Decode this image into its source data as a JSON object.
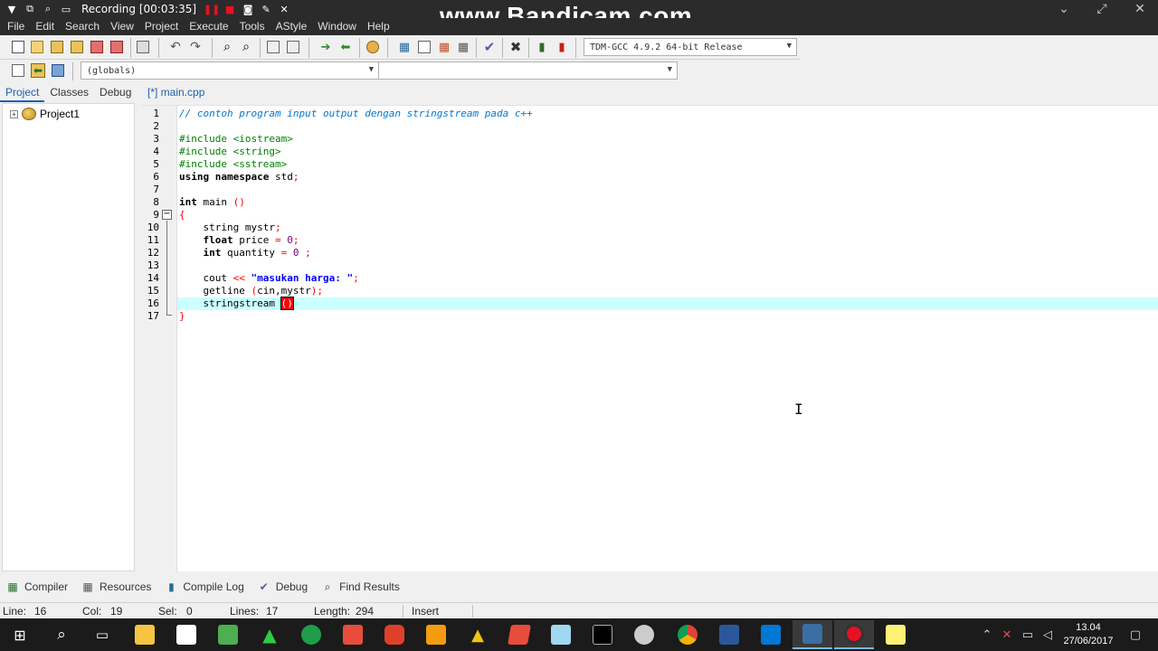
{
  "recording": {
    "label": "Recording [00:03:35]"
  },
  "watermark": "www.Bandicam.com",
  "menu": [
    "File",
    "Edit",
    "Search",
    "View",
    "Project",
    "Execute",
    "Tools",
    "AStyle",
    "Window",
    "Help"
  ],
  "toolbar": {
    "compiler_select": "TDM-GCC 4.9.2 64-bit Release",
    "scope_select": "(globals)"
  },
  "left_panel": {
    "tabs": [
      "Project",
      "Classes",
      "Debug"
    ],
    "active_tab": "Project",
    "tree": {
      "expander": "+",
      "root": "Project1"
    }
  },
  "editor": {
    "tab_label": "[*] main.cpp",
    "current_line": 16,
    "fold_marker": "−"
  },
  "code": {
    "lines": [
      "1",
      "2",
      "3",
      "4",
      "5",
      "6",
      "7",
      "8",
      "9",
      "10",
      "11",
      "12",
      "13",
      "14",
      "15",
      "16",
      "17"
    ],
    "l1": "// contoh program input output dengan stringstream pada c++",
    "l3": "#include <iostream>",
    "l4": "#include <string>",
    "l5": "#include <sstream>",
    "l6_kw1": "using",
    "l6_kw2": "namespace",
    "l6_rest": " std",
    "semi": ";",
    "l8_kw": "int",
    "l8_rest": " main ",
    "parens": "()",
    "open_brace": "{",
    "close_brace": "}",
    "l10": "    string mystr",
    "l11_kw": "float",
    "l11_rest": " price ",
    "eq": "=",
    "zero": "0",
    "l12_kw": "int",
    "l12_rest": " quantity ",
    "l14_a": "    cout ",
    "l14_op": "<<",
    "l14_str": "\"masukan harga: \"",
    "l15_a": "    getline ",
    "l15_paren_open": "(",
    "l15_args": "cin,mystr",
    "l15_paren_close": ")",
    "l16_a": "    stringstream ",
    "l16_match": "()"
  },
  "bottom_tabs": [
    "Compiler",
    "Resources",
    "Compile Log",
    "Debug",
    "Find Results"
  ],
  "status": {
    "line_label": "Line:",
    "line": "16",
    "col_label": "Col:",
    "col": "19",
    "sel_label": "Sel:",
    "sel": "0",
    "lines_label": "Lines:",
    "lines": "17",
    "length_label": "Length:",
    "length": "294",
    "mode": "Insert"
  },
  "clock": {
    "time": "13.04",
    "date": "27/06/2017"
  },
  "colors": {
    "titlebar": "#2b2b2b",
    "highlight_line": "#ccffff",
    "comment": "#0078d7",
    "preprocessor": "#008000",
    "string": "#0000ff",
    "symbol": "#ff0000",
    "number": "#800080"
  }
}
